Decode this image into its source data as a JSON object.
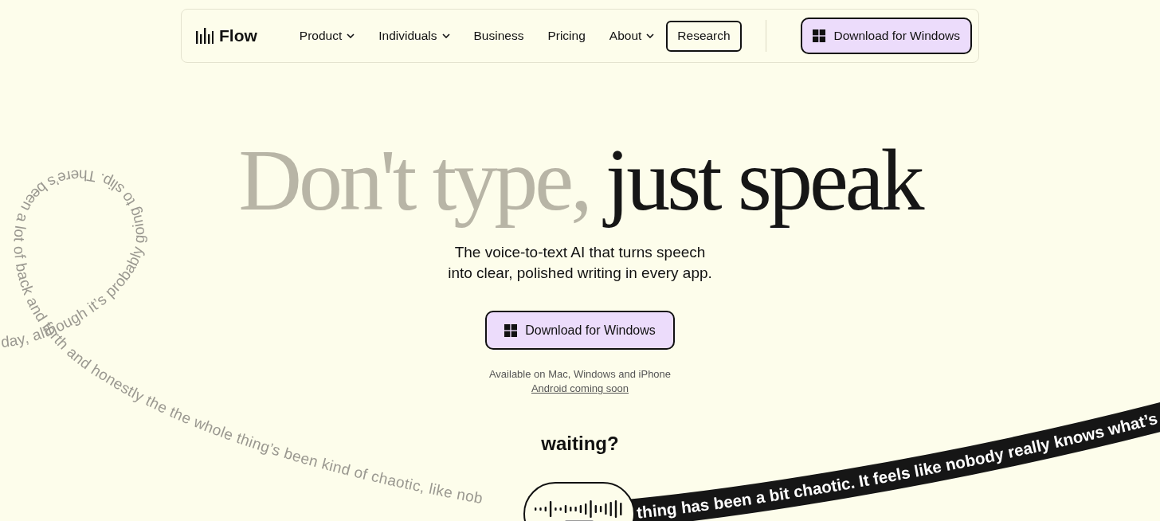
{
  "nav": {
    "logo": "Flow",
    "items": [
      {
        "label": "Product",
        "dropdown": true
      },
      {
        "label": "Individuals",
        "dropdown": true
      },
      {
        "label": "Business",
        "dropdown": false
      },
      {
        "label": "Pricing",
        "dropdown": false
      },
      {
        "label": "About",
        "dropdown": true
      }
    ],
    "research": "Research",
    "cta": "Download for Windows"
  },
  "hero": {
    "title_muted": "Don't type,",
    "title_strong": "just speak",
    "subtitle": [
      "The voice-to-text AI that turns speech",
      "into clear, polished writing in every app."
    ],
    "cta": "Download for Windows",
    "availability": "Available on Mac, Windows and iPhone",
    "android_link": "Android coming soon"
  },
  "demo": {
    "prompt": "waiting?",
    "transcript_faded": "day, although it’s probably going to slip. There’s been a lot of back and forth and honestly the the whole thing’s been kind of chaotic, like nob",
    "transcript_live": "thing has been a bit chaotic. It feels like nobody really knows what’s"
  }
}
